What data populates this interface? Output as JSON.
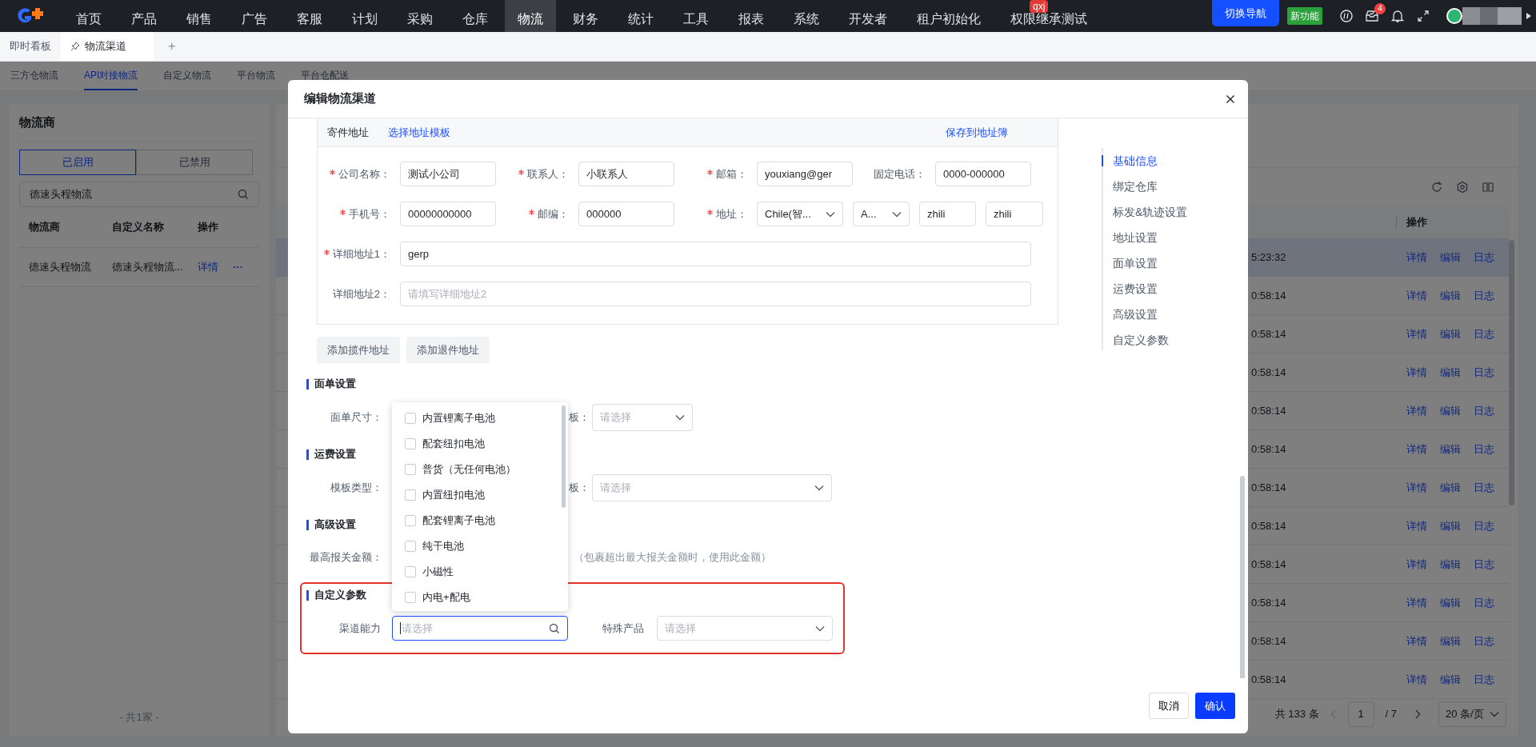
{
  "top_nav": {
    "menu": [
      {
        "label": "首页",
        "selected": false
      },
      {
        "label": "产品",
        "selected": false
      },
      {
        "label": "销售",
        "selected": false
      },
      {
        "label": "广告",
        "selected": false
      },
      {
        "label": "客服",
        "selected": false
      },
      {
        "label": "计划",
        "selected": false
      },
      {
        "label": "采购",
        "selected": false
      },
      {
        "label": "仓库",
        "selected": false
      },
      {
        "label": "物流",
        "selected": true
      },
      {
        "label": "财务",
        "selected": false
      },
      {
        "label": "统计",
        "selected": false
      },
      {
        "label": "工具",
        "selected": false
      },
      {
        "label": "报表",
        "selected": false
      },
      {
        "label": "系统",
        "selected": false
      },
      {
        "label": "开发者",
        "selected": false
      },
      {
        "label": "租户初始化",
        "selected": false
      },
      {
        "label": "权限继承测试",
        "selected": false,
        "badge": "qxj"
      }
    ],
    "switch_button": "切换导航",
    "new_feature": "新功能",
    "notification_count": "4"
  },
  "page_tabs": [
    {
      "label": "即时看板",
      "selected": false,
      "pinned": false
    },
    {
      "label": "物流渠道",
      "selected": true,
      "pinned": true
    }
  ],
  "add_tab": "+",
  "sub_tabs": [
    {
      "label": "三方仓物流",
      "selected": false
    },
    {
      "label": "API对接物流",
      "selected": true
    },
    {
      "label": "自定义物流",
      "selected": false
    },
    {
      "label": "平台物流",
      "selected": false
    },
    {
      "label": "平台仓配送",
      "selected": false
    }
  ],
  "carrier_panel": {
    "title": "物流商",
    "status_toggle": [
      {
        "label": "已启用",
        "selected": true
      },
      {
        "label": "已禁用",
        "selected": false
      }
    ],
    "search": {
      "value": "德速头程物流"
    },
    "columns": [
      "物流商",
      "自定义名称",
      "操作"
    ],
    "rows": [
      {
        "carrier": "德速头程物流",
        "custom_name": "德速头程物流...",
        "action": "详情",
        "more": "···"
      }
    ],
    "footer": "- 共1家 -"
  },
  "channel_table": {
    "action_column": "操作",
    "rows": [
      {
        "time": "5:23:32",
        "selected": true,
        "actions": [
          "详情",
          "编辑",
          "日志"
        ]
      },
      {
        "time": "0:58:14",
        "selected": false,
        "actions": [
          "详情",
          "编辑",
          "日志"
        ]
      },
      {
        "time": "0:58:14",
        "selected": false,
        "actions": [
          "详情",
          "编辑",
          "日志"
        ]
      },
      {
        "time": "0:58:14",
        "selected": false,
        "actions": [
          "详情",
          "编辑",
          "日志"
        ]
      },
      {
        "time": "0:58:14",
        "selected": false,
        "actions": [
          "详情",
          "编辑",
          "日志"
        ]
      },
      {
        "time": "0:58:14",
        "selected": false,
        "actions": [
          "详情",
          "编辑",
          "日志"
        ]
      },
      {
        "time": "0:58:14",
        "selected": false,
        "actions": [
          "详情",
          "编辑",
          "日志"
        ]
      },
      {
        "time": "0:58:14",
        "selected": false,
        "actions": [
          "详情",
          "编辑",
          "日志"
        ]
      },
      {
        "time": "0:58:14",
        "selected": false,
        "actions": [
          "详情",
          "编辑",
          "日志"
        ]
      },
      {
        "time": "0:58:14",
        "selected": false,
        "actions": [
          "详情",
          "编辑",
          "日志"
        ]
      },
      {
        "time": "0:58:14",
        "selected": false,
        "actions": [
          "详情",
          "编辑",
          "日志"
        ]
      },
      {
        "time": "0:58:14",
        "selected": false,
        "actions": [
          "详情",
          "编辑",
          "日志"
        ]
      }
    ],
    "pagination": {
      "total": "共 133 条",
      "page": "1",
      "pages": "/ 7",
      "page_size": "20 条/页"
    }
  },
  "modal": {
    "title": "编辑物流渠道",
    "sender_address": {
      "title": "寄件地址",
      "template_link": "选择地址模板",
      "save_link": "保存到地址簿",
      "rows": [
        [
          {
            "label": "公司名称：",
            "required": true,
            "controls": [
              {
                "kind": "input",
                "value": "测试小公司"
              }
            ]
          },
          {
            "label": "联系人：",
            "required": true,
            "controls": [
              {
                "kind": "input",
                "value": "小联系人"
              }
            ]
          },
          {
            "label": "邮箱：",
            "required": true,
            "controls": [
              {
                "kind": "input",
                "value": "youxiang@ger"
              }
            ]
          },
          {
            "label": "固定电话：",
            "required": false,
            "controls": [
              {
                "kind": "input",
                "value": "0000-000000"
              }
            ]
          }
        ],
        [
          {
            "label": "手机号：",
            "required": true,
            "controls": [
              {
                "kind": "input",
                "value": "00000000000"
              }
            ]
          },
          {
            "label": "邮编：",
            "required": true,
            "controls": [
              {
                "kind": "input",
                "value": "000000"
              }
            ]
          },
          {
            "label": "地址：",
            "required": true,
            "controls": [
              {
                "kind": "select",
                "value": "Chile(智..."
              },
              {
                "kind": "select",
                "value": "A..."
              },
              {
                "kind": "input",
                "value": "zhili"
              },
              {
                "kind": "input",
                "value": "zhili"
              }
            ]
          }
        ],
        [
          {
            "label": "详细地址1：",
            "required": true,
            "controls": [
              {
                "kind": "input",
                "value": "gerp"
              }
            ]
          }
        ],
        [
          {
            "label": "详细地址2：",
            "required": false,
            "controls": [
              {
                "kind": "input",
                "placeholder": "请填写详细地址2"
              }
            ]
          }
        ]
      ]
    },
    "add_buttons": [
      "添加揽件地址",
      "添加退件地址"
    ],
    "sections": [
      {
        "title": "面单设置",
        "label": "面单尺寸：",
        "extra_label": "板：",
        "select": {
          "placeholder": "请选择"
        }
      },
      {
        "title": "运费设置",
        "label": "模板类型：",
        "extra_label": "板：",
        "select": {
          "placeholder": "请选择"
        }
      },
      {
        "title": "高级设置",
        "label": "最高报关金额：",
        "hint": "（包裹超出最大报关金额时，使用此金额）"
      }
    ],
    "custom_params": {
      "title": "自定义参数",
      "highlighted": true,
      "fields": [
        {
          "label": "渠道能力",
          "kind": "search",
          "placeholder": "请选择",
          "focused": true,
          "options": [
            {
              "label": "内置锂离子电池",
              "checked": false
            },
            {
              "label": "配套纽扣电池",
              "checked": false
            },
            {
              "label": "普货（无任何电池）",
              "checked": false
            },
            {
              "label": "内置纽扣电池",
              "checked": false
            },
            {
              "label": "配套锂离子电池",
              "checked": false
            },
            {
              "label": "纯干电池",
              "checked": false
            },
            {
              "label": "小磁性",
              "checked": false
            },
            {
              "label": "内电+配电",
              "checked": false
            }
          ]
        },
        {
          "label": "特殊产品",
          "kind": "select",
          "placeholder": "请选择",
          "focused": false
        }
      ]
    },
    "anchor_nav": [
      {
        "label": "基础信息",
        "selected": true
      },
      {
        "label": "绑定仓库",
        "selected": false
      },
      {
        "label": "标发&轨迹设置",
        "selected": false
      },
      {
        "label": "地址设置",
        "selected": false
      },
      {
        "label": "面单设置",
        "selected": false
      },
      {
        "label": "运费设置",
        "selected": false
      },
      {
        "label": "高级设置",
        "selected": false
      },
      {
        "label": "自定义参数",
        "selected": false
      }
    ],
    "footer": {
      "cancel": "取消",
      "confirm": "确认"
    }
  }
}
